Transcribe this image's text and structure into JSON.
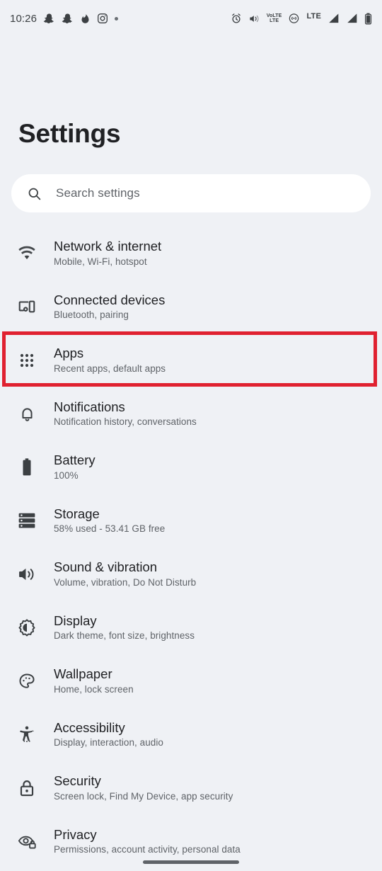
{
  "status_bar": {
    "clock": "10:26",
    "left_icons": [
      "snapchat-icon",
      "snapchat-icon",
      "tinder-flame-icon",
      "instagram-icon",
      "dot-indicator-icon"
    ],
    "right_icons": [
      "alarm-icon",
      "vibrate-icon",
      "volte-icon",
      "wifi-calling-icon",
      "lte-label",
      "signal-bars-sim1-icon",
      "signal-bars-sim2-icon",
      "battery-icon"
    ],
    "volte_top": "VoLTE",
    "volte_bottom": "LTE",
    "network_label": "LTE"
  },
  "header": {
    "title": "Settings"
  },
  "search": {
    "placeholder": "Search settings",
    "icon": "search-icon"
  },
  "list": {
    "items": [
      {
        "id": "network-internet",
        "icon": "wifi-icon",
        "title": "Network & internet",
        "subtitle": "Mobile, Wi-Fi, hotspot",
        "highlighted": false
      },
      {
        "id": "connected-devices",
        "icon": "devices-icon",
        "title": "Connected devices",
        "subtitle": "Bluetooth, pairing",
        "highlighted": false
      },
      {
        "id": "apps",
        "icon": "apps-grid-icon",
        "title": "Apps",
        "subtitle": "Recent apps, default apps",
        "highlighted": true
      },
      {
        "id": "notifications",
        "icon": "bell-icon",
        "title": "Notifications",
        "subtitle": "Notification history, conversations",
        "highlighted": false
      },
      {
        "id": "battery",
        "icon": "battery-icon",
        "title": "Battery",
        "subtitle": "100%",
        "highlighted": false
      },
      {
        "id": "storage",
        "icon": "storage-icon",
        "title": "Storage",
        "subtitle": "58% used - 53.41 GB free",
        "highlighted": false
      },
      {
        "id": "sound-vibration",
        "icon": "volume-icon",
        "title": "Sound & vibration",
        "subtitle": "Volume, vibration, Do Not Disturb",
        "highlighted": false
      },
      {
        "id": "display",
        "icon": "brightness-icon",
        "title": "Display",
        "subtitle": "Dark theme, font size, brightness",
        "highlighted": false
      },
      {
        "id": "wallpaper",
        "icon": "palette-icon",
        "title": "Wallpaper",
        "subtitle": "Home, lock screen",
        "highlighted": false
      },
      {
        "id": "accessibility",
        "icon": "accessibility-icon",
        "title": "Accessibility",
        "subtitle": "Display, interaction, audio",
        "highlighted": false
      },
      {
        "id": "security",
        "icon": "lock-icon",
        "title": "Security",
        "subtitle": "Screen lock, Find My Device, app security",
        "highlighted": false
      },
      {
        "id": "privacy",
        "icon": "eye-lock-icon",
        "title": "Privacy",
        "subtitle": "Permissions, account activity, personal data",
        "highlighted": false
      }
    ]
  },
  "annotation": {
    "target": "Apps",
    "color": "#e02130"
  },
  "colors": {
    "background": "#eff1f5",
    "surface": "#ffffff",
    "text_primary": "#202124",
    "text_secondary": "#5f6368",
    "icon": "#3c4043",
    "highlight": "#e02130"
  },
  "gesture_bar": {
    "name": "home-gesture-pill"
  }
}
